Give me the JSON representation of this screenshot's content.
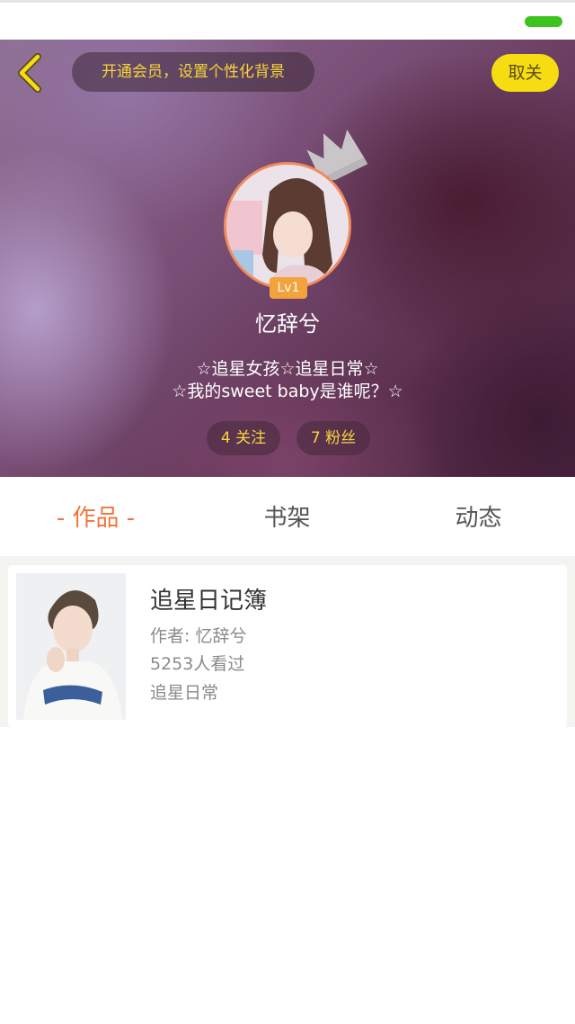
{
  "header": {
    "vip_banner": "开通会员，设置个性化背景",
    "unfollow_button": "取关",
    "level": "Lv1",
    "username": "忆辞兮",
    "bio_line1": "☆追星女孩☆追星日常☆",
    "bio_line2": "☆我的sweet baby是谁呢？☆",
    "following": "4 关注",
    "fans": "7 粉丝"
  },
  "tabs": [
    {
      "label": "- 作品 -",
      "active": true
    },
    {
      "label": "书架",
      "active": false
    },
    {
      "label": "动态",
      "active": false
    }
  ],
  "books": [
    {
      "title": "追星日记簿",
      "author": "作者: 忆辞兮",
      "views": "5253人看过",
      "tag": "追星日常"
    }
  ],
  "colors": {
    "accent_orange": "#f0743c",
    "vip_yellow": "#f7d53c",
    "unfollow_button_bg": "#f6dd12",
    "level_badge_bg": "#f2a33c",
    "avatar_ring": "#f28a5b",
    "battery_green": "#3cc31e"
  },
  "icons": {
    "back": "chevron-left-icon",
    "crown": "crown-icon"
  }
}
